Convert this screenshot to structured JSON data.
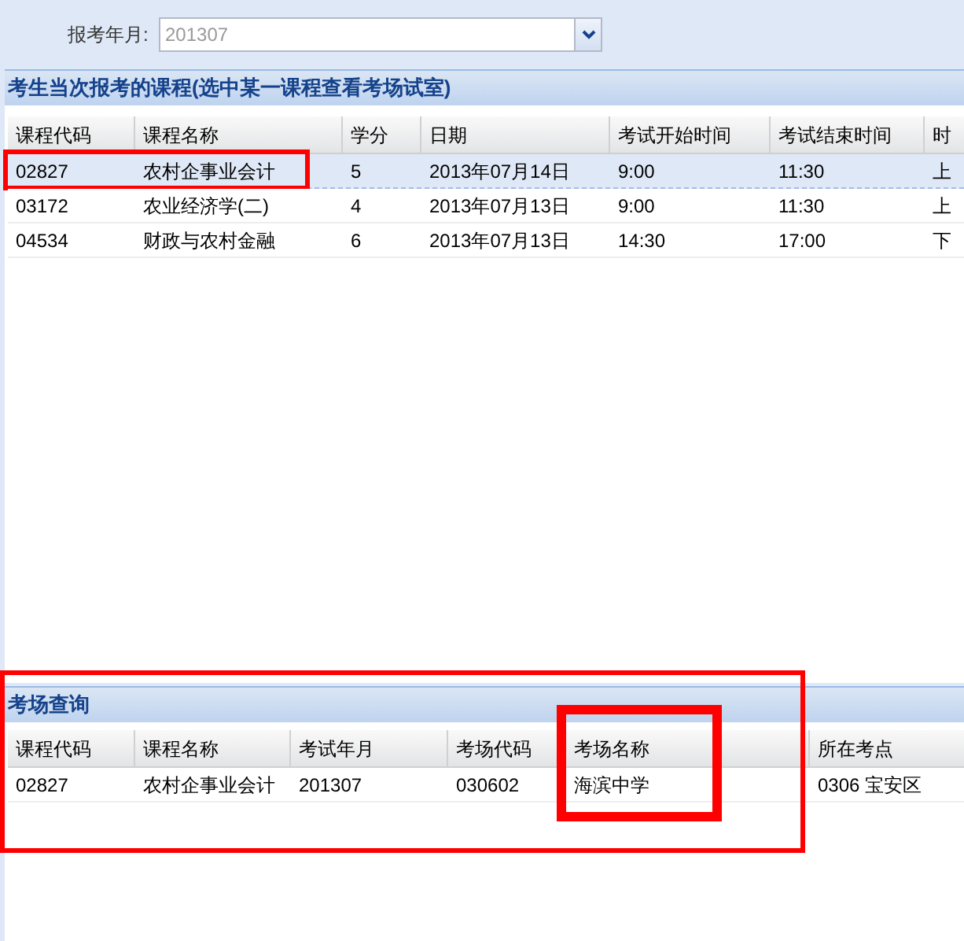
{
  "filter": {
    "label": "报考年月:",
    "value": "201307"
  },
  "courses": {
    "title": "考生当次报考的课程(选中某一课程查看考场试室)",
    "columns": [
      "课程代码",
      "课程名称",
      "学分",
      "日期",
      "考试开始时间",
      "考试结束时间",
      "时"
    ],
    "rows": [
      {
        "selected": true,
        "highlighted": true,
        "cells": [
          "02827",
          "农村企事业会计",
          "5",
          "2013年07月14日",
          "9:00",
          "11:30",
          "上"
        ]
      },
      {
        "selected": false,
        "highlighted": false,
        "cells": [
          "03172",
          "农业经济学(二)",
          "4",
          "2013年07月13日",
          "9:00",
          "11:30",
          "上"
        ]
      },
      {
        "selected": false,
        "highlighted": false,
        "cells": [
          "04534",
          "财政与农村金融",
          "6",
          "2013年07月13日",
          "14:30",
          "17:00",
          "下"
        ]
      }
    ]
  },
  "venues": {
    "title": "考场查询",
    "highlighted": true,
    "columns": [
      {
        "label": "课程代码",
        "highlighted": false
      },
      {
        "label": "课程名称",
        "highlighted": false
      },
      {
        "label": "考试年月",
        "highlighted": false
      },
      {
        "label": "考场代码",
        "highlighted": false
      },
      {
        "label": "考场名称",
        "highlighted": true
      },
      {
        "label": "所在考点",
        "highlighted": false
      }
    ],
    "rows": [
      [
        "02827",
        "农村企事业会计",
        "201307",
        "030602",
        "海滨中学",
        "0306 宝安区"
      ]
    ]
  }
}
